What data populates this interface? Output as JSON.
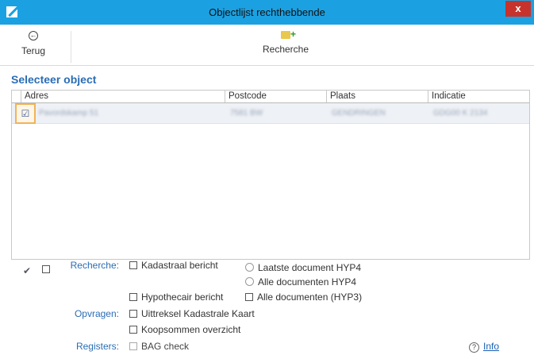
{
  "window": {
    "title": "Objectlijst rechthebbende",
    "close_label": "x"
  },
  "toolbar": {
    "back_label": "Terug",
    "recherche_label": "Recherche"
  },
  "section": {
    "title": "Selecteer object"
  },
  "grid": {
    "columns": [
      "Adres",
      "Postcode",
      "Plaats",
      "Indicatie"
    ],
    "rows": [
      {
        "adres": "Pavordskamp 51",
        "postcode": "7581 BW",
        "plaats": "GENDRINGEN",
        "indicatie": "GDG00 K 2134"
      }
    ]
  },
  "options": {
    "recherche_label": "Recherche:",
    "kadastraal_bericht": "Kadastraal bericht",
    "laatste_document": "Laatste document HYP4",
    "alle_documenten_hyp4": "Alle documenten HYP4",
    "hypothecair_bericht": "Hypothecair bericht",
    "alle_documenten_hyp3": "Alle documenten (HYP3)",
    "opvragen_label": "Opvragen:",
    "uittreksel": "Uittreksel Kadastrale Kaart",
    "koopsommen": "Koopsommen overzicht",
    "registers_label": "Registers:",
    "bag_check": "BAG check",
    "info_label": "Info"
  },
  "colors": {
    "titlebar": "#1ba1e2",
    "accent": "#2a6db5",
    "close": "#c7332c",
    "selection": "#f0b35a"
  }
}
